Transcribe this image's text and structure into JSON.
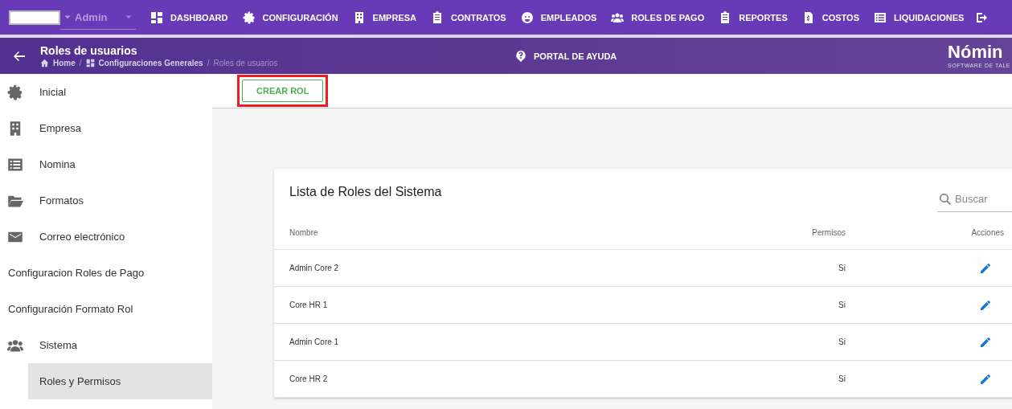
{
  "top_bar": {
    "user_select": "Admin",
    "nav": [
      {
        "label": "DASHBOARD"
      },
      {
        "label": "CONFIGURACIÓN"
      },
      {
        "label": "EMPRESA"
      },
      {
        "label": "CONTRATOS"
      },
      {
        "label": "EMPLEADOS"
      },
      {
        "label": "ROLES DE PAGO"
      },
      {
        "label": "REPORTES"
      },
      {
        "label": "COSTOS"
      },
      {
        "label": "LIQUIDACIONES"
      }
    ]
  },
  "header": {
    "title": "Roles de usuarios",
    "breadcrumbs": [
      {
        "label": "Home"
      },
      {
        "label": "Configuraciones Generales"
      },
      {
        "label": "Roles de usuarios"
      }
    ],
    "breadcrumb_separator": "/",
    "help_link": "PORTAL DE AYUDA",
    "logo": {
      "name": "Nómin",
      "tagline": "SOFTWARE DE TALE"
    }
  },
  "sidebar": {
    "items": [
      {
        "label": "Inicial",
        "selected": false
      },
      {
        "label": "Empresa",
        "selected": false
      },
      {
        "label": "Nomina",
        "selected": false
      },
      {
        "label": "Formatos",
        "selected": false
      },
      {
        "label": "Correo electrónico",
        "selected": false
      },
      {
        "label": "Configuracion Roles de Pago",
        "selected": false
      },
      {
        "label": "Configuración Formato Rol",
        "selected": false
      },
      {
        "label": "Sistema",
        "selected": false,
        "children": [
          {
            "label": "Roles y Permisos",
            "selected": true
          }
        ]
      }
    ]
  },
  "toolbar": {
    "create_button": "CREAR ROL",
    "highlighted": true
  },
  "card": {
    "title": "Lista de Roles del Sistema",
    "search": {
      "placeholder": "Buscar"
    },
    "columns": [
      "Nombre",
      "Permisos",
      "Acciones"
    ],
    "rows": [
      {
        "name": "Admin Core 2",
        "permisos": "Si"
      },
      {
        "name": "Core HR 1",
        "permisos": "Si"
      },
      {
        "name": "Admin Core 1",
        "permisos": "Si"
      },
      {
        "name": "Core HR 2",
        "permisos": "Si"
      }
    ]
  }
}
